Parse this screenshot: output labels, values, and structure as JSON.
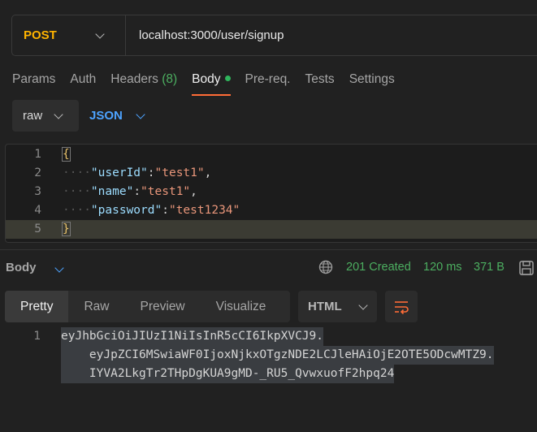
{
  "request": {
    "method": "POST",
    "url": "localhost:3000/user/signup"
  },
  "tabs": [
    {
      "label": "Params"
    },
    {
      "label": "Auth"
    },
    {
      "label": "Headers",
      "count": "(8)"
    },
    {
      "label": "Body"
    },
    {
      "label": "Pre-req."
    },
    {
      "label": "Tests"
    },
    {
      "label": "Settings"
    }
  ],
  "body_type": {
    "mode": "raw",
    "language": "JSON"
  },
  "editor": {
    "lines": [
      "1",
      "2",
      "3",
      "4",
      "5"
    ],
    "open_brace": "{",
    "close_brace": "}",
    "fields": [
      {
        "key": "\"userId\"",
        "value": "\"test1\"",
        "trail": ","
      },
      {
        "key": "\"name\"",
        "value": "\"test1\"",
        "trail": ","
      },
      {
        "key": "\"password\"",
        "value": "\"test1234\"",
        "trail": ""
      }
    ]
  },
  "response": {
    "title": "Body",
    "status": "201 Created",
    "time": "120 ms",
    "size": "371 B",
    "views": [
      "Pretty",
      "Raw",
      "Preview",
      "Visualize"
    ],
    "format": "HTML",
    "line_number": "1",
    "lines": [
      "eyJhbGciOiJIUzI1NiIsInR5cCI6IkpXVCJ9.",
      "    eyJpZCI6MSwiaWF0IjoxNjkxOTgzNDE2LCJleHAiOjE2OTE5ODcwMTZ9.",
      "    IYVA2LkgTr2THpDgKUA9gMD-_RU5_QvwxuofF2hpq24"
    ]
  },
  "colors": {
    "accent": "#ff6c37",
    "method": "#ffb400",
    "status_ok": "#4cae60",
    "link": "#4da3ff"
  },
  "icons": [
    "chevron-down-icon",
    "globe-icon",
    "save-icon",
    "wrap-lines-icon"
  ]
}
